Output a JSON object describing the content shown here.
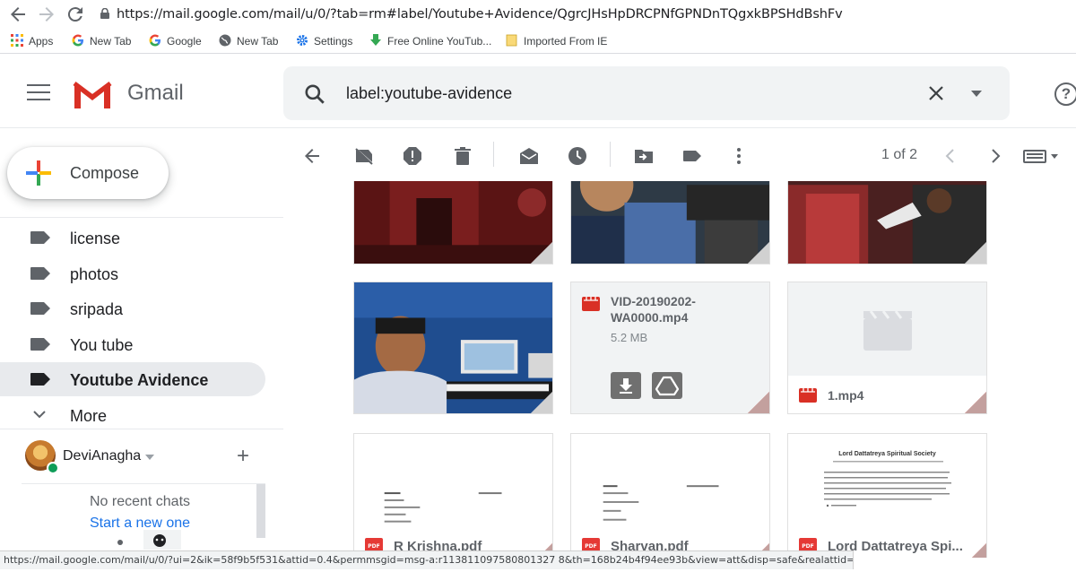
{
  "browser": {
    "url": "https://mail.google.com/mail/u/0/?tab=rm#label/Youtube+Avidence/QgrcJHsHpDRCPNfGPNDnTQgxkBPSHdBshFv",
    "bookmarks": [
      {
        "label": "Apps",
        "icon": "apps-grid-icon"
      },
      {
        "label": "New Tab",
        "icon": "google-g-icon"
      },
      {
        "label": "Google",
        "icon": "google-g-icon"
      },
      {
        "label": "New Tab",
        "icon": "globe-icon"
      },
      {
        "label": "Settings",
        "icon": "gear-icon"
      },
      {
        "label": "Free Online YouTub...",
        "icon": "download-arrow-icon"
      },
      {
        "label": "Imported From IE",
        "icon": "folder-icon"
      }
    ],
    "status_url": "https://mail.google.com/mail/u/0/?ui=2&ik=58f9b5f531&attid=0.4&permmsgid=msg-a:r113811097580801327 8&th=168b24b4f94ee93b&view=att&disp=safe&realattid=f_jrolb9y04"
  },
  "header": {
    "app_name": "Gmail",
    "search_query": "label:youtube-avidence",
    "help_glyph": "?"
  },
  "sidebar": {
    "compose_label": "Compose",
    "labels": [
      {
        "label": "license",
        "active": false
      },
      {
        "label": "photos",
        "active": false
      },
      {
        "label": "sripada",
        "active": false
      },
      {
        "label": "You tube",
        "active": false
      },
      {
        "label": "Youtube Avidence",
        "active": true
      }
    ],
    "more_label": "More"
  },
  "hangouts": {
    "username": "DeviAnagha",
    "add_glyph": "+",
    "no_chats": "No recent chats",
    "start_new": "Start a new one"
  },
  "toolbar": {
    "pager": "1 of 2"
  },
  "attachments": {
    "video1_name": "VID-20190202-WA0000.mp4",
    "video1_name_line1": "VID-20190202-",
    "video1_name_line2": "WA0000.mp4",
    "video1_size": "5.2 MB",
    "video2_name": "1.mp4",
    "pdf1_name": "R Krishna.pdf",
    "pdf2_name": "Sharvan.pdf",
    "pdf3_name": "Lord Dattatreya Spi...",
    "pdf3_heading": "Lord Dattatreya Spiritual Society",
    "pdf_badge_text": "PDF"
  },
  "colors": {
    "gmail_red": "#d93025",
    "link_blue": "#1a73e8",
    "active_label_bg": "#e8eaed",
    "icon_grey": "#5f6368"
  }
}
